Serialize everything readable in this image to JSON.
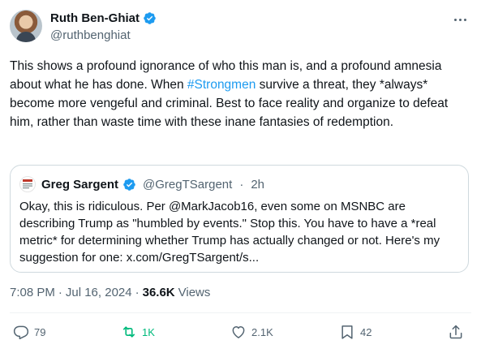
{
  "author": {
    "display_name": "Ruth Ben-Ghiat",
    "handle": "@ruthbenghiat"
  },
  "tweet": {
    "text_before": "This shows a profound ignorance of who this man is, and a profound amnesia about what he has done. When ",
    "hashtag": "#Strongmen",
    "text_after": " survive a threat, they *always* become more vengeful and criminal. Best to face reality and organize to defeat him, rather than waste time with these inane fantasies of redemption."
  },
  "quote": {
    "display_name": "Greg Sargent",
    "handle": "@GregTSargent",
    "separator": "·",
    "time": "2h",
    "text": "Okay, this is ridiculous. Per @MarkJacob16, even some on MSNBC are describing Trump as \"humbled by events.\" Stop this. You have to have a *real metric* for determining whether Trump has actually changed or not. Here's my suggestion for one: x.com/GregTSargent/s..."
  },
  "meta": {
    "time": "7:08 PM",
    "sep1": "·",
    "date": "Jul 16, 2024",
    "sep2": "·",
    "views_count": "36.6K",
    "views_label": "Views"
  },
  "actions": {
    "replies": "79",
    "reposts": "1K",
    "likes": "2.1K",
    "bookmarks": "42"
  },
  "colors": {
    "accent": "#1d9bf0",
    "repost_active": "#00ba7c",
    "muted": "#536471",
    "text": "#0f1419",
    "border": "#cfd9de"
  },
  "icons": {
    "verified": "verified-badge-icon",
    "more": "more-icon",
    "reply": "reply-icon",
    "repost": "repost-icon",
    "like": "heart-icon",
    "bookmark": "bookmark-icon",
    "share": "share-icon"
  }
}
